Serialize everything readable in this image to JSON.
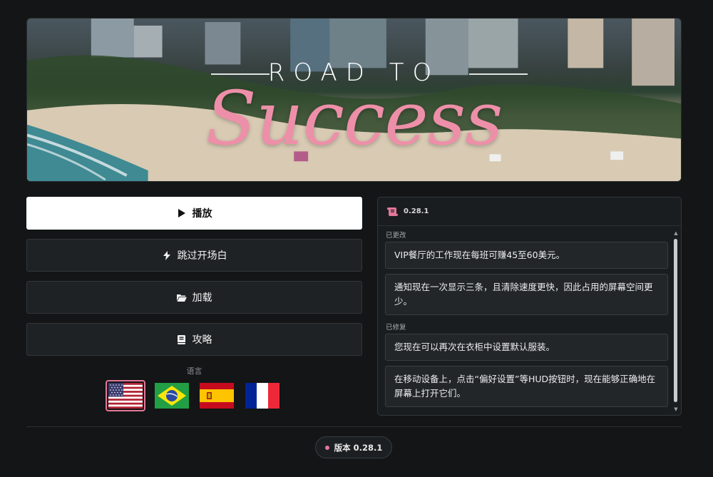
{
  "banner": {
    "title_top": "ROAD TO",
    "title_script": "Success"
  },
  "menu": {
    "play_label": "播放",
    "skip_intro_label": "跳过开场白",
    "load_label": "加载",
    "guide_label": "攻略"
  },
  "language": {
    "label": "语言",
    "options": [
      {
        "icon": "us-flag-icon",
        "selected": true
      },
      {
        "icon": "brazil-flag-icon",
        "selected": false
      },
      {
        "icon": "spain-flag-icon",
        "selected": false
      },
      {
        "icon": "france-flag-icon",
        "selected": false
      }
    ]
  },
  "changelog": {
    "version": "0.28.1",
    "icon": "scroll-icon",
    "sections": [
      {
        "label": "已更改",
        "notes": [
          "VIP餐厅的工作现在每班可赚45至60美元。",
          "通知现在一次显示三条，且清除速度更快，因此占用的屏幕空间更少。"
        ]
      },
      {
        "label": "已修复",
        "notes": [
          "您现在可以再次在衣柜中设置默认服装。",
          "在移动设备上，点击“偏好设置”等HUD按钮时，现在能够正确地在屏幕上打开它们。"
        ]
      }
    ]
  },
  "footer": {
    "version_label": "版本 0.28.1"
  },
  "colors": {
    "accent": "#e3779a",
    "background": "#131516",
    "panel": "#1a1d1f",
    "primary_button": "#ffffff"
  }
}
